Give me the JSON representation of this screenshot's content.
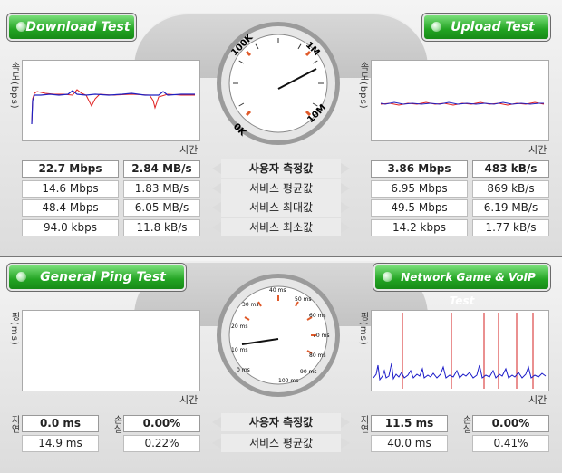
{
  "top": {
    "download_button": "Download Test",
    "upload_button": "Upload Test",
    "y_label": "속도(bps)",
    "x_label": "시간",
    "gauge_ticks": [
      "0K",
      "100K",
      "1M",
      "10M"
    ],
    "row_labels": [
      "사용자 측정값",
      "서비스 평균값",
      "서비스 최대값",
      "서비스 최소값"
    ],
    "download": {
      "mbps": [
        "22.7 Mbps",
        "14.6 Mbps",
        "48.4 Mbps",
        "94.0 kbps"
      ],
      "bytes": [
        "2.84 MB/s",
        "1.83 MB/s",
        "6.05 MB/s",
        "11.8 kB/s"
      ]
    },
    "upload": {
      "mbps": [
        "3.86 Mbps",
        "6.95 Mbps",
        "49.5 Mbps",
        "14.2 kbps"
      ],
      "bytes": [
        "483 kB/s",
        "869 kB/s",
        "6.19 MB/s",
        "1.77 kB/s"
      ]
    }
  },
  "bottom": {
    "ping_button": "General Ping Test",
    "game_button": "Network Game & VoIP Test",
    "y_label": "핑(ms)",
    "x_label": "시간",
    "gauge_ticks": [
      "0 ms",
      "10 ms",
      "20 ms",
      "30 ms",
      "40 ms",
      "50 ms",
      "60 ms",
      "70 ms",
      "80 ms",
      "90 ms",
      "100 ms"
    ],
    "delay_label": "지연",
    "loss_label": "손실",
    "row_labels": [
      "사용자 측정값",
      "서비스 평균값"
    ],
    "ping": {
      "delay": [
        "0.0 ms",
        "14.9 ms"
      ],
      "loss": [
        "0.00%",
        "0.22%"
      ]
    },
    "game": {
      "delay": [
        "11.5 ms",
        "40.0 ms"
      ],
      "loss": [
        "0.00%",
        "0.41%"
      ]
    }
  }
}
